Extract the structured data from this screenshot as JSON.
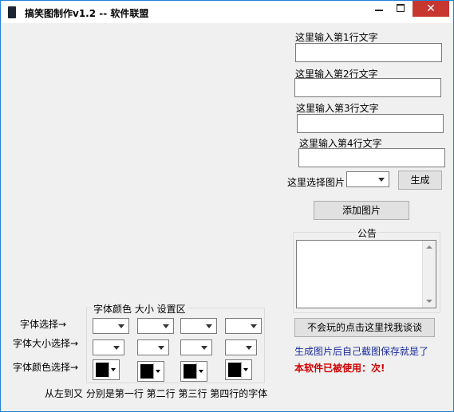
{
  "window": {
    "title": "搞笑图制作v1.2  --  软件联盟",
    "minimize_label": "",
    "maximize_label": "",
    "close_label": "✕"
  },
  "inputs": {
    "line1_label": "这里输入第1行文字",
    "line1_value": "",
    "line2_label": "这里输入第2行文字",
    "line2_value": "",
    "line3_label": "这里输入第3行文字",
    "line3_value": "",
    "line4_label": "这里输入第4行文字",
    "line4_value": ""
  },
  "image_select": {
    "label": "这里选择图片",
    "value": "",
    "generate_button": "生成",
    "add_image_button": "添加图片"
  },
  "notice": {
    "legend": "公告",
    "content": "",
    "help_button": "不会玩的点击这里找我谈谈",
    "tip_text": "生成图片后自己截图保存就是了",
    "usage_text": "本软件已被使用：次!"
  },
  "font_settings": {
    "group_legend": "字体颜色  大小  设置区",
    "font_select_label": "字体选择→",
    "size_select_label": "字体大小选择→",
    "color_select_label": "字体颜色选择→",
    "footer_text": "从左到又  分别是第一行  第二行  第三行  第四行的字体",
    "font_values": [
      "",
      "",
      "",
      ""
    ],
    "size_values": [
      "",
      "",
      "",
      ""
    ],
    "colors": [
      "#000000",
      "#000000",
      "#000000",
      "#000000"
    ]
  }
}
